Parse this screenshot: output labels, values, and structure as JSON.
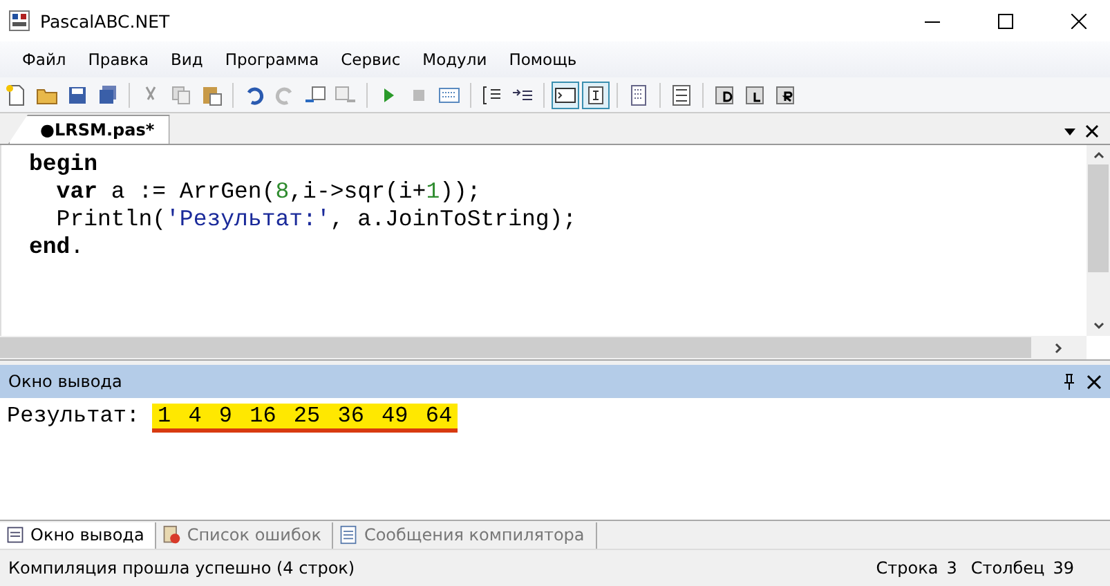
{
  "window": {
    "title": "PascalABC.NET"
  },
  "menu": [
    "Файл",
    "Правка",
    "Вид",
    "Программа",
    "Сервис",
    "Модули",
    "Помощь"
  ],
  "toolbar": {
    "toggles": [
      {
        "pressed": true
      },
      {
        "pressed": true
      }
    ]
  },
  "editor_tabs": [
    {
      "label": "●LRSM.pas*",
      "selected": true
    }
  ],
  "code": [
    [
      {
        "kind": "kw",
        "text": "begin"
      }
    ],
    [
      {
        "kind": "kw",
        "text": "  var"
      },
      {
        "kind": "plain",
        "text": " a := ArrGen("
      },
      {
        "kind": "num",
        "text": "8"
      },
      {
        "kind": "plain",
        "text": ",i->sqr(i+"
      },
      {
        "kind": "num",
        "text": "1"
      },
      {
        "kind": "plain",
        "text": "));"
      }
    ],
    [
      {
        "kind": "plain",
        "text": "  Println("
      },
      {
        "kind": "str",
        "text": "'Результат:'"
      },
      {
        "kind": "plain",
        "text": ", a.JoinToString);"
      }
    ],
    [
      {
        "kind": "kw",
        "text": "end"
      },
      {
        "kind": "plain",
        "text": "."
      }
    ]
  ],
  "output_panel": {
    "title": "Окно вывода",
    "label": "Результат:",
    "highlighted": "1 4 9 16 25 36 49 64"
  },
  "bottom_tabs": [
    {
      "label": "Окно вывода",
      "selected": true
    },
    {
      "label": "Список ошибок",
      "selected": false
    },
    {
      "label": "Сообщения компилятора",
      "selected": false
    }
  ],
  "status_bar": {
    "message": "Компиляция прошла успешно (4 строк)",
    "line_label": "Строка",
    "line": "3",
    "column_label": "Столбец",
    "column": "39"
  }
}
